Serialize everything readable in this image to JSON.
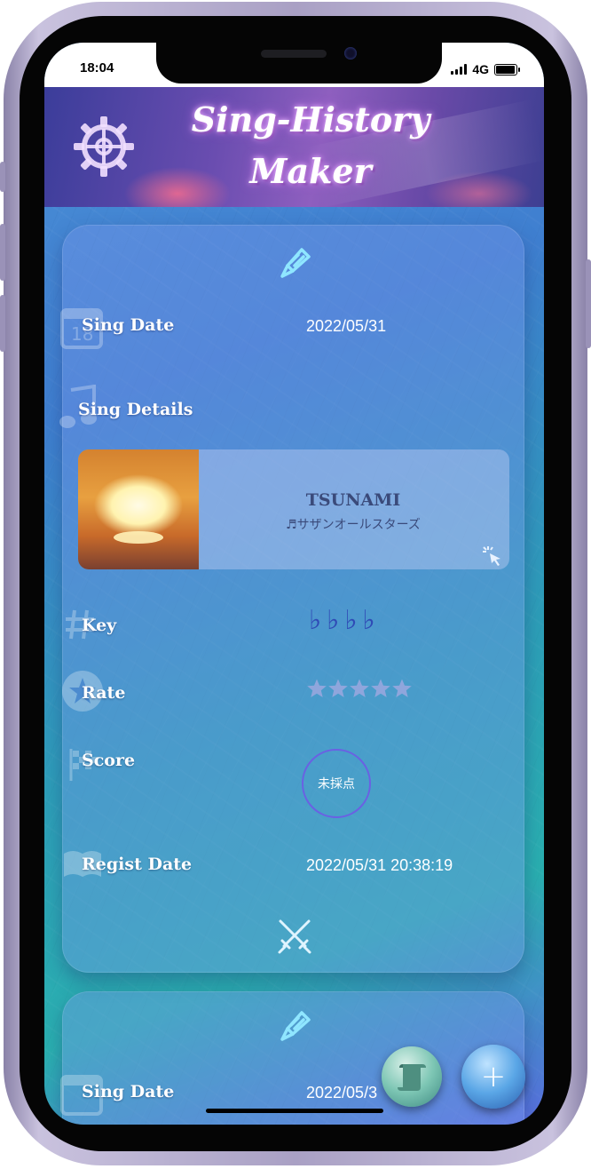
{
  "status_bar": {
    "time": "18:04",
    "network": "4G"
  },
  "header": {
    "title_line1": "Sing-History",
    "title_line2": "Maker"
  },
  "icons": {
    "settings": "gear-icon",
    "edit": "pencil-icon",
    "delete": "crossed-swords-icon",
    "tap": "tap-icon",
    "history": "scroll-icon",
    "add": "plus-icon"
  },
  "record": {
    "sing_date_label": "Sing Date",
    "sing_date": "2022/05/31",
    "sing_details_label": "Sing Details",
    "song_title": "TSUNAMI",
    "song_artist": "サザンオールスターズ",
    "key_label": "Key",
    "key_flats": [
      "♭",
      "♭",
      "♭",
      "♭"
    ],
    "rate_label": "Rate",
    "rate_value": 0,
    "rate_max": 5,
    "score_label": "Score",
    "score_value": "未採点",
    "regist_date_label": "Regist Date",
    "regist_date": "2022/05/31 20:38:19"
  },
  "record2": {
    "sing_date_label": "Sing Date",
    "sing_date": "2022/05/3"
  },
  "fab": {
    "add_label": "+"
  },
  "colors": {
    "accent": "#2f4ab6",
    "star_empty": "#8fa6dc",
    "score_ring": "#6e5ae6"
  }
}
